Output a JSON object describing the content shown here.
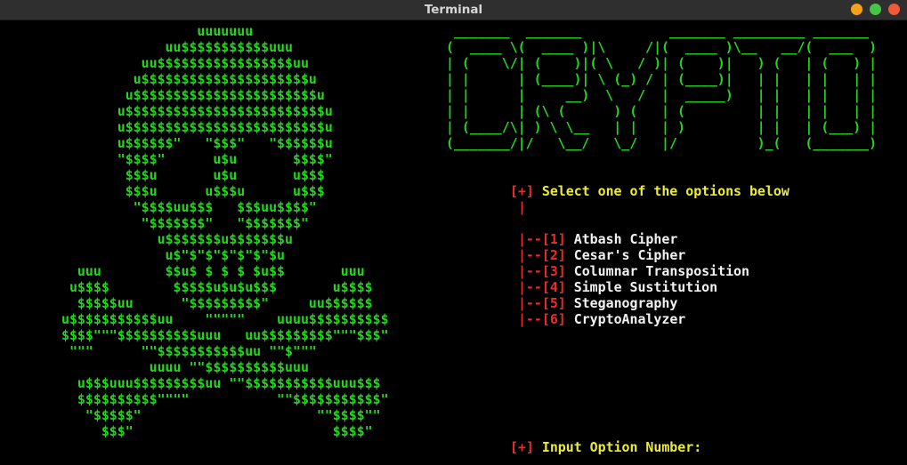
{
  "window": {
    "title": "Terminal"
  },
  "skull_art": "                 uuuuuuu\n             uu$$$$$$$$$$$uuu\n          uu$$$$$$$$$$$$$$$$$uu\n         u$$$$$$$$$$$$$$$$$$$$$u\n        u$$$$$$$$$$$$$$$$$$$$$$$u\n       u$$$$$$$$$$$$$$$$$$$$$$$$$u\n       u$$$$$$$$$$$$$$$$$$$$$$$$$u\n       u$$$$$$\"   \"$$$\"   \"$$$$$$u\n       \"$$$$\"      u$u       $$$$\"\n        $$$u       u$u       u$$$\n        $$$u      u$$$u      u$$$\n         \"$$$$uu$$$   $$$uu$$$$\"\n          \"$$$$$$$\"   \"$$$$$$$\"\n            u$$$$$$$u$$$$$$$u\n             u$\"$\"$\"$\"$\"$\"$u\n  uuu        $$u$ $ $ $ $u$$       uuu\n u$$$$        $$$$$u$u$u$$$       u$$$$\n  $$$$$uu      \"$$$$$$$$$\"     uu$$$$$$\nu$$$$$$$$$$$uu    \"\"\"\"\"    uuuu$$$$$$$$$$\n$$$$\"\"\"$$$$$$$$$$uuu   uu$$$$$$$$$\"\"\"$$$\"\n \"\"\"      \"\"$$$$$$$$$$$uu \"\"$\"\"\"\n           uuuu \"\"$$$$$$$$$$uuu\n  u$$$uuu$$$$$$$$$uu \"\"$$$$$$$$$$$uuu$$$\n  $$$$$$$$$$\"\"\"\"           \"\"$$$$$$$$$$$\"\n   \"$$$$$\"                      \"\"$$$$\"\"\n     $$$\"                         $$$$\"",
  "logo_art": " _______  _______           _______ _________ _______ \n(  ____ \\(  ____ )|\\     /|(  ____ )\\__   __/(  ___  )\n| (    \\/| (    )|( \\   / )| (    )|   ) (   | (   ) |\n| |      | (____)| \\ (_) / | (____)|   | |   | |   | |\n| |      |     __)  \\   /  |  _____)   | |   | |   | |\n| |      | (\\ (      ) (   | (         | |   | |   | |\n| (____/\\| ) \\ \\__   | |   | )         | |   | (___) |\n(_______/|/   \\__/   \\_/   |/          )_(   (_______)",
  "menu": {
    "header_tag": "[+]",
    "header_text": " Select one of the options below",
    "connector": " |",
    "branch": " |--",
    "options": [
      {
        "num": "[1]",
        "label": " Atbash Cipher"
      },
      {
        "num": "[2]",
        "label": " Cesar's Cipher"
      },
      {
        "num": "[3]",
        "label": " Columnar Transposition"
      },
      {
        "num": "[4]",
        "label": " Simple Sustitution"
      },
      {
        "num": "[5]",
        "label": " Steganography"
      },
      {
        "num": "[6]",
        "label": " CryptoAnalyzer"
      }
    ]
  },
  "prompt": {
    "tag": "[+]",
    "text": " Input Option Number:"
  },
  "colors": {
    "background": "#000000",
    "art": "#22d81c",
    "accent_red": "#ee2a2a",
    "accent_yellow": "#ecec36",
    "option_text": "#f2f2f2"
  }
}
